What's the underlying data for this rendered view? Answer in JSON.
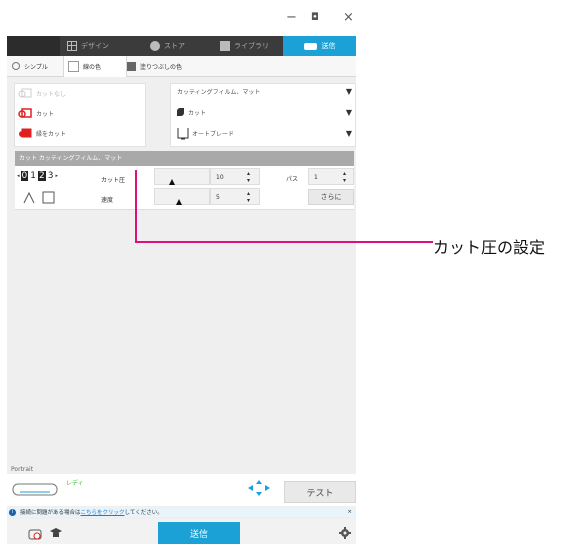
{
  "window": {
    "minimize": "−",
    "maximize": "◘",
    "close": "×"
  },
  "nav": {
    "tabs": [
      {
        "label": "デザイン",
        "icon": "grid-icon"
      },
      {
        "label": "ストア",
        "icon": "store-icon"
      },
      {
        "label": "ライブラリ",
        "icon": "library-icon"
      }
    ],
    "send": {
      "label": "送信",
      "icon": "cutter-icon"
    }
  },
  "modes": [
    {
      "label": "シンプル"
    },
    {
      "label": "線の色"
    },
    {
      "label": "塗りつぶしの色"
    }
  ],
  "cut_options": [
    {
      "label": "カットなし"
    },
    {
      "label": "カット"
    },
    {
      "label": "縁をカット"
    }
  ],
  "material": {
    "media": "カッティングフィルム、マット",
    "action": "カット",
    "tool": "オートブレード"
  },
  "section_title": "カット カッティングフィルム、マット",
  "conditions": {
    "blade_digits": [
      "0",
      "1",
      "2",
      "3"
    ],
    "force_label": "カット圧",
    "force_value": "10",
    "speed_label": "速度",
    "speed_value": "5",
    "passes_label": "パス",
    "passes_value": "1",
    "more_label": "さらに"
  },
  "orientation_label": "Portrait",
  "device": {
    "status": "レディ"
  },
  "test_label": "テスト",
  "info": {
    "prefix": "接続に問題がある場合は",
    "link": "こちらをクリック",
    "suffix": "してください。",
    "close": "×"
  },
  "footer": {
    "send_label": "送信"
  },
  "callout": "カット圧の設定",
  "colors": {
    "accent": "#1ba1d6",
    "nav_bg": "#3b3b3b",
    "cut_red": "#e02020",
    "ready_green": "#3bbf3b"
  }
}
